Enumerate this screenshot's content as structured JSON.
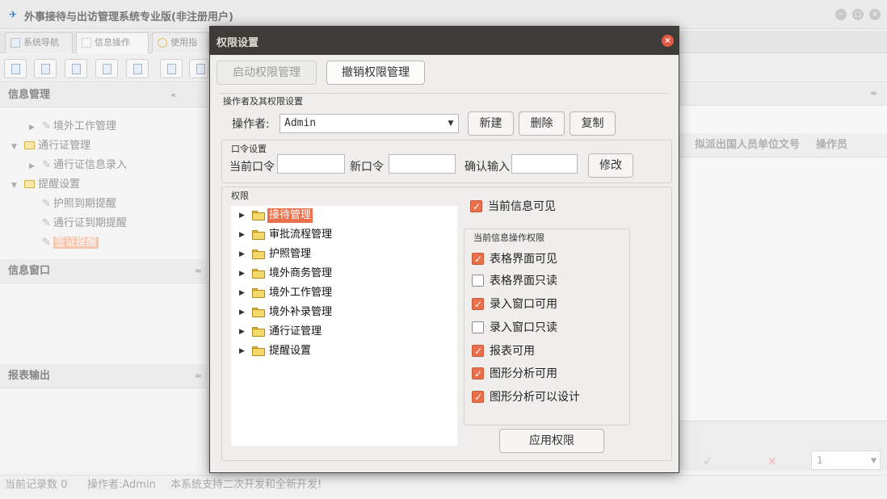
{
  "app": {
    "title": "外事接待与出访管理系统专业版(非注册用户)",
    "nav_tabs": [
      "系统导航",
      "信息操作",
      "使用指"
    ]
  },
  "left": {
    "info_header": "信息管理",
    "info_collapse": "«",
    "tree": {
      "item1": "境外工作管理",
      "item2": "通行证管理",
      "item3": "通行证信息录入",
      "item4": "提醒设置",
      "item5": "护照到期提醒",
      "item6": "通行证到期提醒",
      "item7": "签证提醒"
    },
    "window_header": "信息窗口",
    "report_header": "报表输出",
    "expand_glyph": "≈"
  },
  "right": {
    "col1": "拟派出国人员单位文号",
    "col2": "操作员",
    "collapse": "≈",
    "page_value": "1"
  },
  "status": {
    "records": "当前记录数 0",
    "operator": "操作者:Admin",
    "notice": "本系统支持二次开发和全新开发!"
  },
  "dialog": {
    "title": "权限设置",
    "enable_btn": "启动权限管理",
    "revoke_btn": "撤销权限管理",
    "operator_group_label": "操作者及其权限设置",
    "operator_label": "操作者:",
    "operator_value": "Admin",
    "new_btn": "新建",
    "delete_btn": "删除",
    "copy_btn": "复制",
    "password_group_label": "口令设置",
    "current_pwd_label": "当前口令",
    "new_pwd_label": "新口令",
    "confirm_pwd_label": "确认输入",
    "modify_btn": "修改",
    "perm_group_label": "权限",
    "tree_nodes": [
      "接待管理",
      "审批流程管理",
      "护照管理",
      "境外商务管理",
      "境外工作管理",
      "境外补录管理",
      "通行证管理",
      "提醒设置"
    ],
    "current_visible_label": "当前信息可见",
    "ops_group_label": "当前信息操作权限",
    "checks": [
      {
        "label": "表格界面可见",
        "checked": true
      },
      {
        "label": "表格界面只读",
        "checked": false
      },
      {
        "label": "录入窗口可用",
        "checked": true
      },
      {
        "label": "录入窗口只读",
        "checked": false
      },
      {
        "label": "报表可用",
        "checked": true
      },
      {
        "label": "图形分析可用",
        "checked": true
      },
      {
        "label": "图形分析可以设计",
        "checked": true
      }
    ],
    "apply_btn": "应用权限"
  }
}
